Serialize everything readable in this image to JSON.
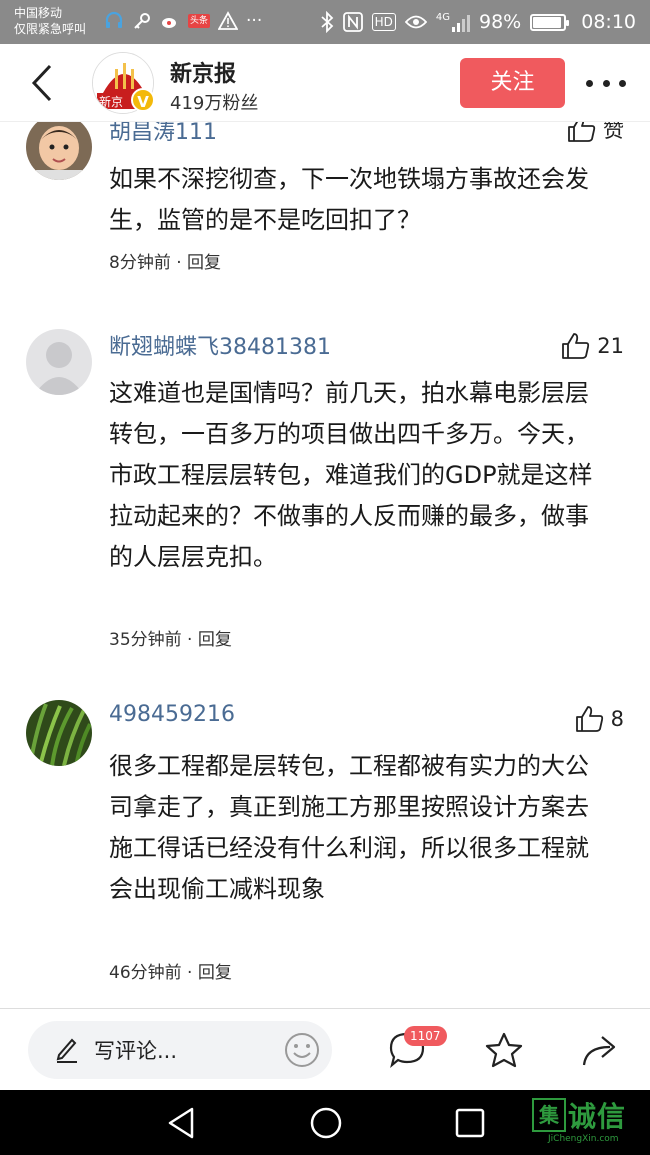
{
  "status_bar": {
    "carrier_line1": "中国移动",
    "carrier_line2": "仅限紧急呼叫",
    "battery": "98%",
    "time": "08:10",
    "app_badge": "头条",
    "signal_label": "4G",
    "hd_label": "HD",
    "battery_level": 0.98
  },
  "header": {
    "publisher_name": "新京报",
    "logo_text": "新京",
    "verified_mark": "V",
    "fans": "419万粉丝",
    "follow_label": "关注"
  },
  "comments": [
    {
      "user": "胡昌涛111",
      "like_label": "赞",
      "text": "如果不深挖彻查，下一次地铁塌方事故还会发生，监管的是不是吃回扣了？",
      "time": "8分钟前",
      "reply_label": "回复",
      "avatar": "child-photo"
    },
    {
      "user": "断翅蝴蝶飞38481381",
      "like_label": "21",
      "text": "这难道也是国情吗？前几天，拍水幕电影层层转包，一百多万的项目做出四千多万。今天，市政工程层层转包，难道我们的GDP就是这样拉动起来的？不做事的人反而赚的最多，做事的人层层克扣。",
      "time": "35分钟前",
      "reply_label": "回复",
      "avatar": "default-gray"
    },
    {
      "user": "498459216",
      "like_label": "8",
      "text": "很多工程都是层转包，工程都被有实力的大公司拿走了，真正到施工方那里按照设计方案去施工得话已经没有什么利润，所以很多工程就会出现偷工减料现象",
      "time": "46分钟前",
      "reply_label": "回复",
      "avatar": "green-plants"
    }
  ],
  "action_bar": {
    "input_placeholder": "写评论...",
    "comment_count": "1107"
  },
  "watermark": {
    "box_char": "集",
    "text": "诚信",
    "sub": "JiChengXin.com"
  },
  "colors": {
    "accent": "#f05a5e",
    "username": "#4a6b93",
    "watermark": "#2e9a3e"
  }
}
